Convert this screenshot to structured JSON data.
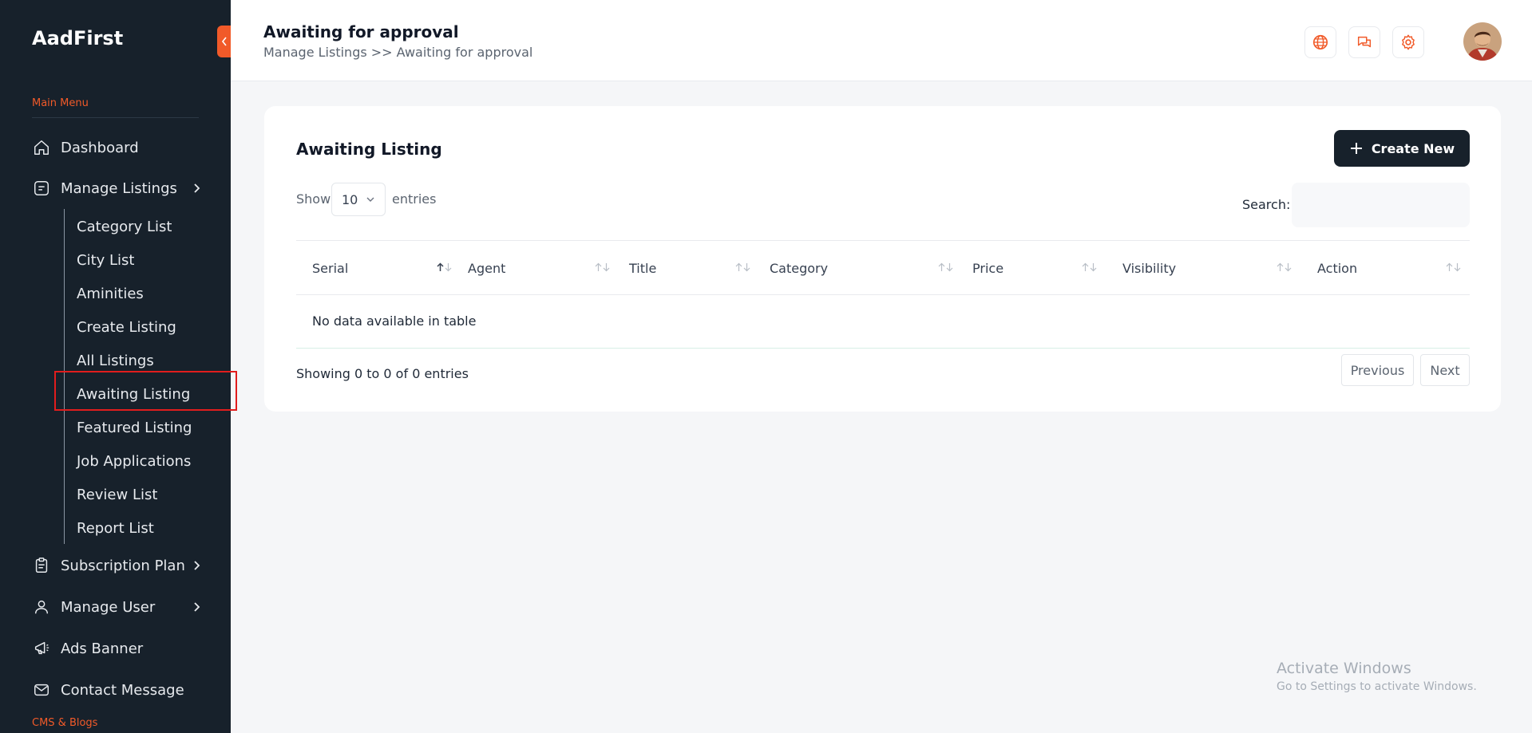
{
  "brand": "AadFirst",
  "sidebar": {
    "section_main": "Main Menu",
    "section_cms": "CMS & Blogs",
    "items": {
      "dashboard": "Dashboard",
      "manage_listings": "Manage Listings",
      "subscription_plan": "Subscription Plan",
      "manage_user": "Manage User",
      "ads_banner": "Ads Banner",
      "contact_message": "Contact Message"
    },
    "sub_items": [
      "Category List",
      "City List",
      "Aminities",
      "Create Listing",
      "All Listings",
      "Awaiting Listing",
      "Featured Listing",
      "Job Applications",
      "Review List",
      "Report List"
    ],
    "active_sub_item": "Awaiting Listing"
  },
  "header": {
    "title": "Awaiting for approval",
    "breadcrumb": "Manage Listings >> Awaiting for approval",
    "icons": [
      "globe-icon",
      "chat-icon",
      "gear-icon"
    ]
  },
  "card": {
    "title": "Awaiting Listing",
    "create_button": "Create New",
    "show_label": "Show",
    "entries_value": "10",
    "entries_label": "entries",
    "search_label": "Search:",
    "search_value": "",
    "columns": [
      "Serial",
      "Agent",
      "Title",
      "Category",
      "Price",
      "Visibility",
      "Action"
    ],
    "empty_message": "No data available in table",
    "info": "Showing 0 to 0 of 0 entries",
    "pagination": {
      "previous": "Previous",
      "next": "Next"
    }
  },
  "watermark": {
    "line1": "Activate Windows",
    "line2": "Go to Settings to activate Windows."
  },
  "colors": {
    "sidebar_bg": "#17212b",
    "accent": "#f15a29",
    "highlight": "#e11d1d"
  }
}
